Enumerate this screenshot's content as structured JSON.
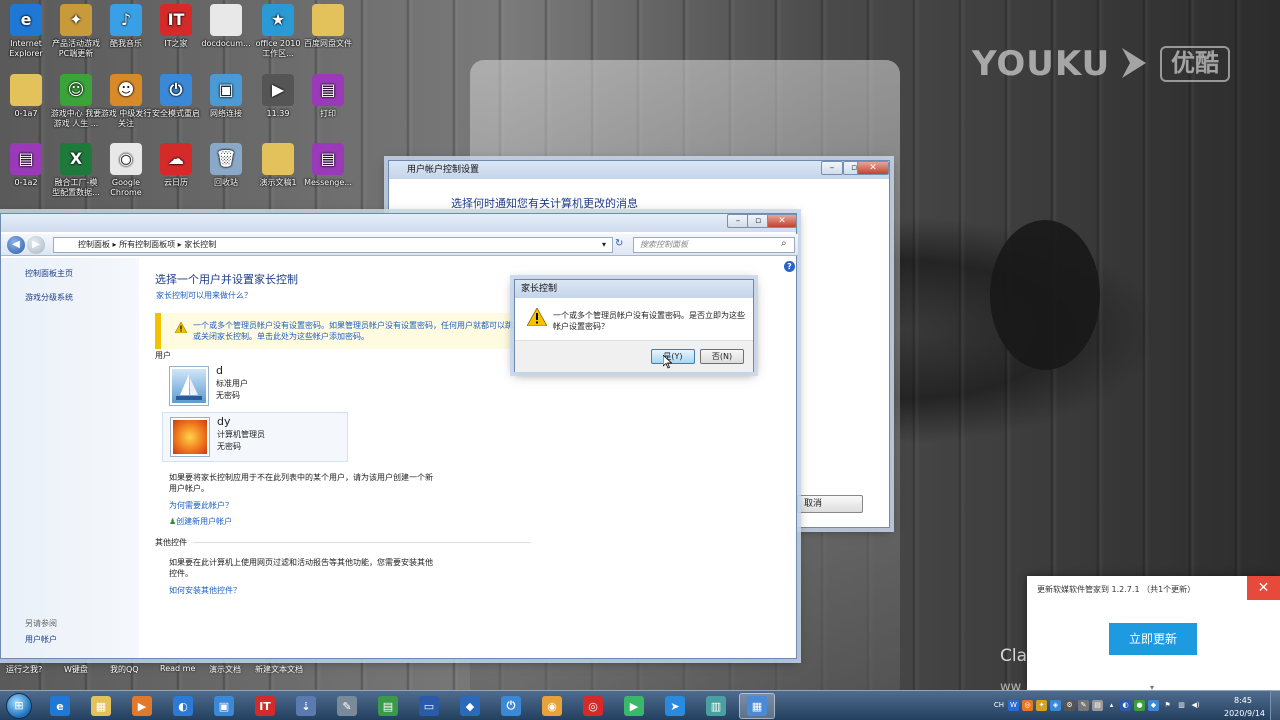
{
  "watermark": {
    "brand_en": "YOUKU",
    "brand_cn": "优酷"
  },
  "background_text": {
    "cla": "Cla",
    "ww": "ww"
  },
  "desktop_icons": [
    {
      "label": "Internet Explorer",
      "icon": "internet-explorer-icon",
      "color": "#1e78d4",
      "glyph": "e"
    },
    {
      "label": "产品活动游戏PC端更新",
      "icon": "game-icon",
      "color": "#c89a3a",
      "glyph": "✦"
    },
    {
      "label": "酷我音乐",
      "icon": "music-player-icon",
      "color": "#3aa0e6",
      "glyph": "♪"
    },
    {
      "label": "IT之家",
      "icon": "it-home-icon",
      "color": "#d42a2a",
      "glyph": "IT"
    },
    {
      "label": "docdocum...",
      "icon": "document-file-icon",
      "color": "#e8e8e8",
      "glyph": ""
    },
    {
      "label": "office 2010 工作区...",
      "icon": "office-star-icon",
      "color": "#2a9ad6",
      "glyph": "★"
    },
    {
      "label": "百度网盘文件",
      "icon": "folder-icon",
      "color": "#e3c15b",
      "glyph": ""
    },
    {
      "label": "0-1a7",
      "icon": "folder-icon",
      "color": "#e3c15b",
      "glyph": ""
    },
    {
      "label": "游戏中心 我要游戏 人生 ...",
      "icon": "game-center-icon",
      "color": "#3aa33a",
      "glyph": "☺"
    },
    {
      "label": "游戏 中级发行 关注",
      "icon": "character-icon",
      "color": "#d88a2a",
      "glyph": "☻"
    },
    {
      "label": "安全模式重启",
      "icon": "power-icon",
      "color": "#3a88d6",
      "glyph": "⏻"
    },
    {
      "label": "网络连接",
      "icon": "network-icon",
      "color": "#4a9ad6",
      "glyph": "▣"
    },
    {
      "label": "11.39",
      "icon": "video-file-icon",
      "color": "#555555",
      "glyph": "▶"
    },
    {
      "label": "打印",
      "icon": "winrar-archive-icon",
      "color": "#9a3ab8",
      "glyph": "▤"
    },
    {
      "label": "0-1a2",
      "icon": "winrar-archive-icon",
      "color": "#9a3ab8",
      "glyph": "▤"
    },
    {
      "label": "融合工厂-模 型配置数据...",
      "icon": "excel-file-icon",
      "color": "#1e7a3a",
      "glyph": "X"
    },
    {
      "label": "Google Chrome",
      "icon": "chrome-icon",
      "color": "#e8e8e8",
      "glyph": "◉"
    },
    {
      "label": "云日历",
      "icon": "cloud-calendar-icon",
      "color": "#d42a2a",
      "glyph": "☁"
    },
    {
      "label": "回收站",
      "icon": "recycle-bin-icon",
      "color": "#8aa8c8",
      "glyph": "🗑"
    },
    {
      "label": "演示文稿1",
      "icon": "folder-icon",
      "color": "#e3c15b",
      "glyph": ""
    },
    {
      "label": "Messenge...",
      "icon": "winrar-archive-icon",
      "color": "#9a3ab8",
      "glyph": "▤"
    }
  ],
  "uac_window": {
    "title": "用户帐户控制设置",
    "heading": "选择何时通知您有关计算机更改的消息",
    "cancel_label": "取消"
  },
  "control_panel": {
    "breadcrumb": [
      "控制面板",
      "所有控制面板项",
      "家长控制"
    ],
    "search_placeholder": "搜索控制面板",
    "sidebar": {
      "home_link": "控制面板主页",
      "game_ratings_link": "游戏分级系统",
      "see_also_heading": "另请参阅",
      "user_accounts_link": "用户帐户"
    },
    "heading": "选择一个用户并设置家长控制",
    "what_can_do_link": "家长控制可以用来做什么？",
    "warning_line1": "一个或多个管理员帐户没有设置密码。如果管理员帐户没有设置密码，任何用户就都可以跳过",
    "warning_line2": "或关闭家长控制。单击此处为这些帐户添加密码。",
    "users_label": "用户",
    "users": [
      {
        "name": "d",
        "role": "标准用户",
        "password": "无密码",
        "avatar": "sailboat-avatar"
      },
      {
        "name": "dy",
        "role": "计算机管理员",
        "password": "无密码",
        "avatar": "flower-avatar"
      }
    ],
    "other_user_text_line1": "如果要将家长控制应用于不在此列表中的某个用户，请为该用户创建一个新",
    "other_user_text_line2": "用户帐户。",
    "why_account_link": "为何需要此帐户？",
    "create_account_link": "创建新用户帐户",
    "other_controls_label": "其他控件",
    "other_controls_text_line1": "如果要在此计算机上使用网页过滤和活动报告等其他功能，您需要安装其他",
    "other_controls_text_line2": "控件。",
    "install_other_link": "如何安装其他控件？"
  },
  "dialog": {
    "title": "家长控制",
    "message": "一个或多个管理员帐户没有设置密码。是否立即为这些帐户设置密码？",
    "yes_label": "是(Y)",
    "no_label": "否(N)"
  },
  "quick_links": [
    "运行之我?",
    "W键盘",
    "我的QQ",
    "Read me",
    "演示文档",
    "新建文本文档"
  ],
  "notification": {
    "text": "更新软媒软件管家到 1.2.7.1 （共1个更新）",
    "button_label": "立即更新",
    "close_label": "✕"
  },
  "taskbar": {
    "apps": [
      {
        "name": "internet-explorer",
        "glyph": "e",
        "color": "#1e78d4"
      },
      {
        "name": "file-explorer",
        "glyph": "▦",
        "color": "#e3c15b"
      },
      {
        "name": "media-player",
        "glyph": "▶",
        "color": "#e07a2a"
      },
      {
        "name": "browser-swirl",
        "glyph": "◐",
        "color": "#2a7ad6"
      },
      {
        "name": "app-store",
        "glyph": "▣",
        "color": "#3a88d6"
      },
      {
        "name": "it-home",
        "glyph": "IT",
        "color": "#d42a2a"
      },
      {
        "name": "installer",
        "glyph": "⇣",
        "color": "#5a7ab0"
      },
      {
        "name": "tools",
        "glyph": "✎",
        "color": "#7a8a9a"
      },
      {
        "name": "green-app",
        "glyph": "▤",
        "color": "#3a9a4a"
      },
      {
        "name": "display-settings",
        "glyph": "▭",
        "color": "#2a5aa8"
      },
      {
        "name": "shield-app",
        "glyph": "◆",
        "color": "#2a6ab8"
      },
      {
        "name": "power-app",
        "glyph": "⏻",
        "color": "#3a88d6"
      },
      {
        "name": "chrome",
        "glyph": "◉",
        "color": "#e8a23a"
      },
      {
        "name": "netease-music",
        "glyph": "◎",
        "color": "#d42a2a"
      },
      {
        "name": "video-player",
        "glyph": "▶",
        "color": "#3ab86a"
      },
      {
        "name": "messenger",
        "glyph": "➤",
        "color": "#2a8ae0"
      },
      {
        "name": "document-app",
        "glyph": "▥",
        "color": "#4aa0a0"
      },
      {
        "name": "control-panel",
        "glyph": "▦",
        "color": "#4a8ad6"
      }
    ],
    "language_indicator": "CH",
    "clock_time": "8:45",
    "clock_date": "2020/9/14"
  }
}
